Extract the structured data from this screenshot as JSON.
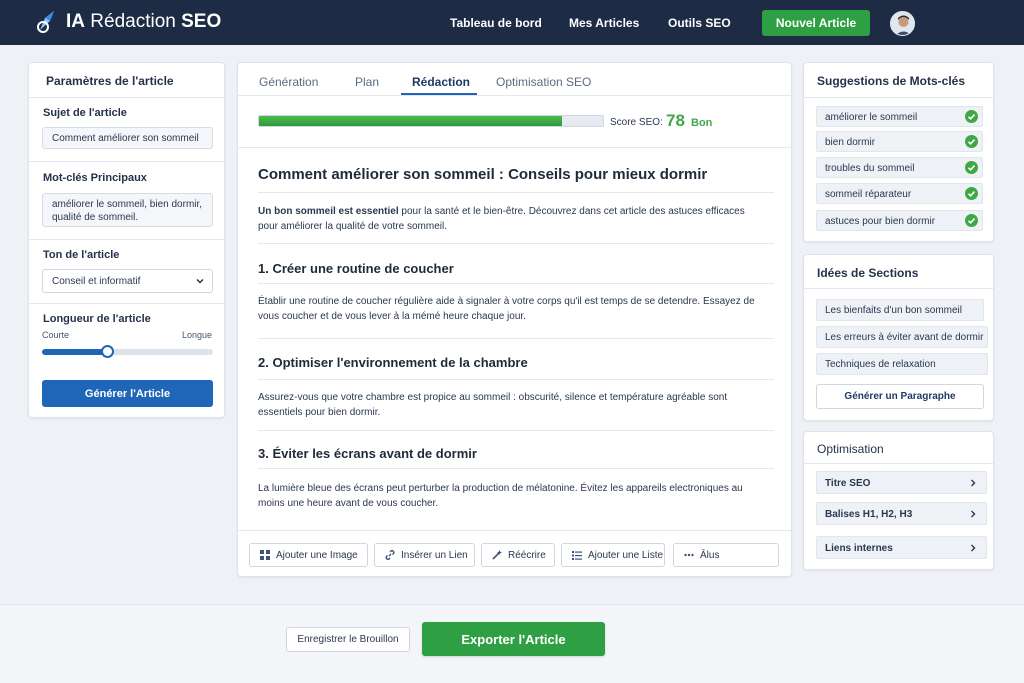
{
  "header": {
    "brand_prefix": "IA",
    "brand_rest": "Rédaction",
    "brand_bold": "SEO",
    "nav": [
      "Tableau de bord",
      "Mes Articles",
      "Outils SEO"
    ],
    "new_article": "Nouvel Article",
    "colors": {
      "background": "#1d2b45",
      "accent": "#2ea043"
    },
    "icons": {
      "logo": "rocket-logo-icon",
      "avatar": "user-avatar"
    }
  },
  "left": {
    "title": "Paramètres de l'article",
    "subject_label": "Sujet de l'article",
    "subject_value": "Comment améliorer son sommeil",
    "keywords_label": "Mot-clés Principaux",
    "keywords_value": "améliorer le sommeil, bien dormir, qualité de sommeil.",
    "tone_label": "Ton de l'article",
    "tone_value": "Conseil et informatif",
    "length_label": "Longueur de l'article",
    "length_min": "Courte",
    "length_max": "Longue",
    "length_level": 0.38,
    "generate": "Générer l'Article"
  },
  "center": {
    "tabs": [
      "Génération",
      "Plan",
      "Rédaction",
      "Optimisation SEO"
    ],
    "active_tab": "Rédaction",
    "score_label": "Score SEO:",
    "score_value": "78",
    "score_text": "Bon",
    "score_fraction": 0.88,
    "article_title": "Comment améliorer son sommeil : Conseils pour mieux dormir",
    "intro_bold": "Un bon sommeil est essentiel",
    "intro_rest": " pour la santé et le bien-être. Découvrez dans cet article des astuces efficaces pour améliorer la qualité de votre sommeil.",
    "sections": [
      {
        "heading": "1. Créer une routine de coucher",
        "text": "Établir une routine de coucher régulière aide à signaler à votre corps qu'il est temps de se detendre. Essayez de vous coucher et de vous lever à la mémé heure chaque jour."
      },
      {
        "heading": "2. Optimiser l'environnement de la chambre",
        "text": "Assurez-vous que votre chambre est propice au sommeil : obscurité, silence et température agréable sont essentiels pour bien dormir."
      },
      {
        "heading": "3. Éviter les écrans avant de dormir",
        "text": "La lumière bleue des écrans peut perturber la production de mélatonine. Évitez les appareils electroniques au moins une heure avant de vous coucher."
      }
    ],
    "tools": {
      "image": "Ajouter une Image",
      "link": "Insérer un Lien",
      "rewrite": "Réécrire",
      "list": "Ajouter une Liste",
      "more": "Ālus"
    }
  },
  "keywords": {
    "title": "Suggestions de Mots-clés",
    "items": [
      "améliorer le sommeil",
      "bien dormir",
      "troubles du sommeil",
      "sommeil réparateur",
      "astuces pour bien dormir"
    ]
  },
  "sections_panel": {
    "title": "Idées de Sections",
    "items": [
      "Les bienfaits d'un bon sommeil",
      "Les erreurs à éviter avant de dormir",
      "Techniques de relaxation"
    ],
    "button": "Générer un Paragraphe"
  },
  "optimisation": {
    "title": "Optimisation",
    "items": [
      "Titre SEO",
      "Balises H1, H2, H3",
      "Liens internes"
    ]
  },
  "footer": {
    "draft": "Enregistrer le Brouillon",
    "export": "Exporter l'Article"
  }
}
